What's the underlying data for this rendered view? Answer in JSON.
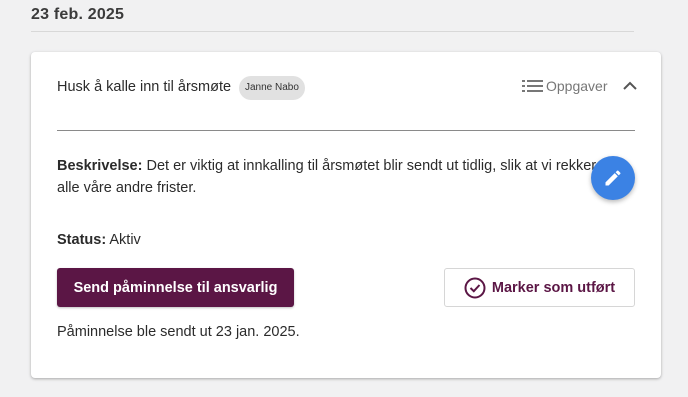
{
  "date_header": "23 feb. 2025",
  "task": {
    "title": "Husk å kalle inn til årsmøte",
    "assignee": "Janne Nabo",
    "tasks_link_label": "Oppgaver",
    "description_label": "Beskrivelse:",
    "description_text": "Det er viktig at innkalling til årsmøtet blir sendt ut tidlig, slik at vi rekker alle våre andre frister.",
    "status_label": "Status:",
    "status_value": "Aktiv",
    "remind_button_label": "Send påminnelse til ansvarlig",
    "done_button_label": "Marker som utført",
    "reminder_note": "Påminnelse ble sendt ut 23 jan. 2025."
  },
  "icons": {
    "tasks": "list-icon",
    "collapse": "chevron-up-icon",
    "edit": "pencil-icon",
    "done": "check-circle-icon"
  },
  "colors": {
    "primary": "#5b1645",
    "fab": "#3b82e4",
    "chip_bg": "#e1e1e1",
    "page_bg": "#f1f1f2"
  }
}
